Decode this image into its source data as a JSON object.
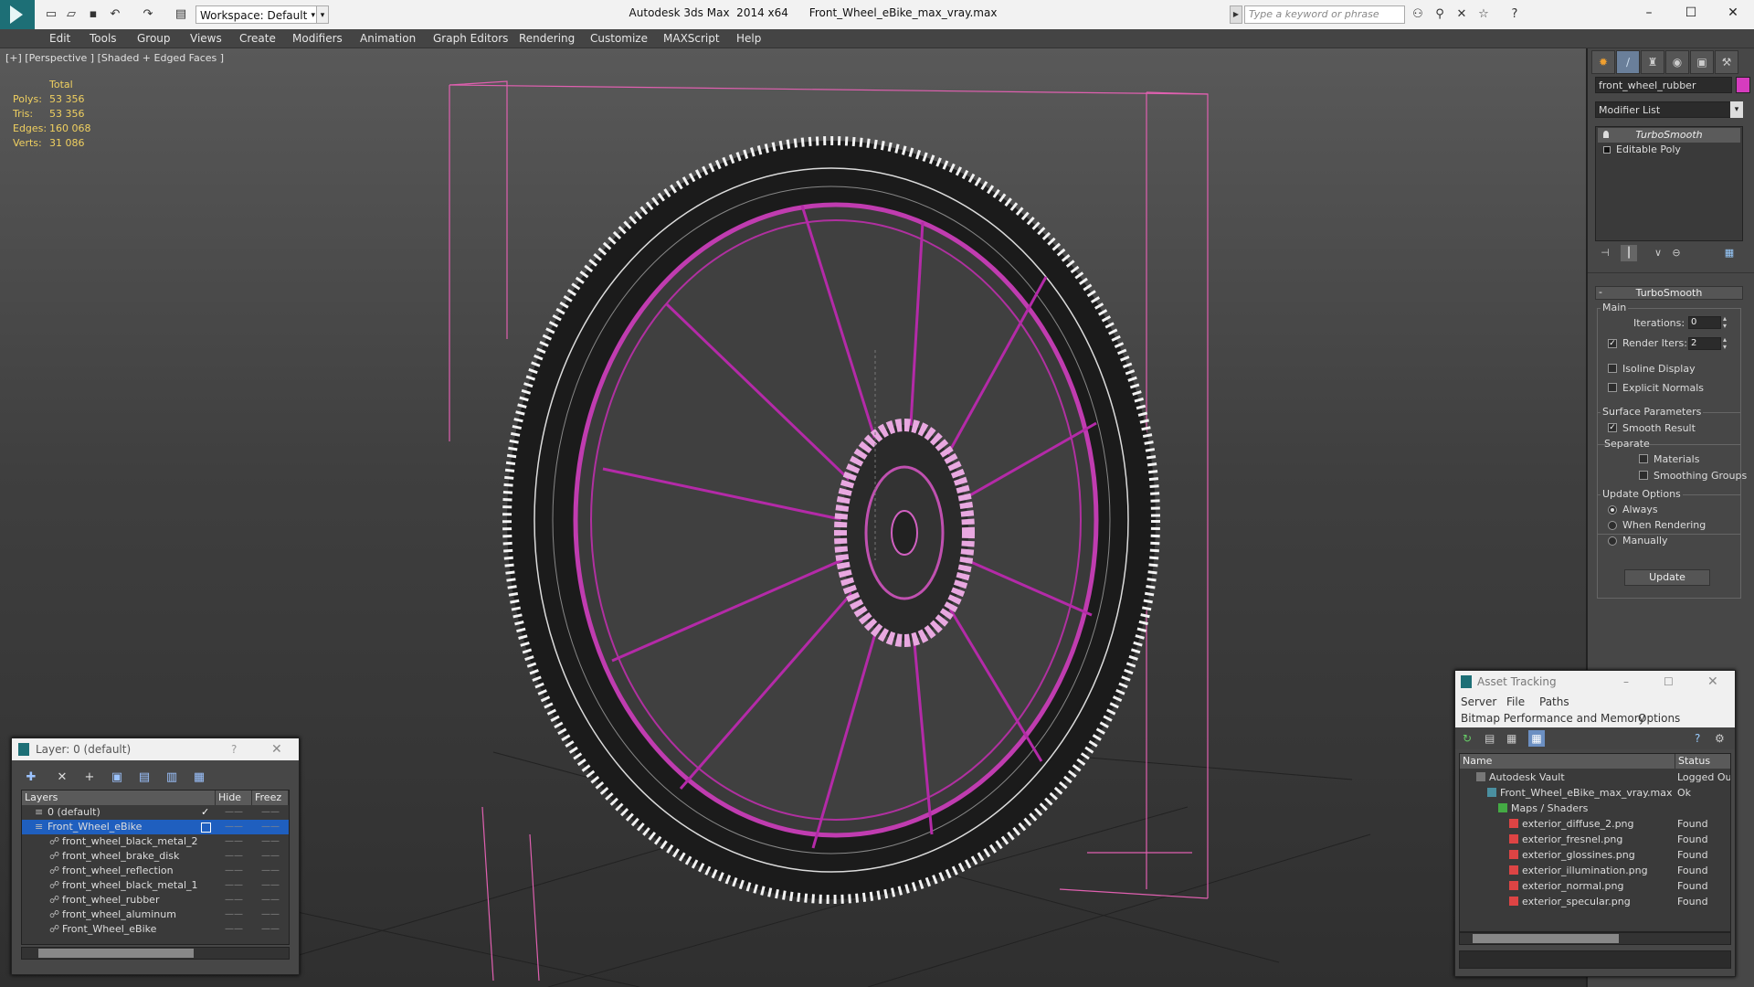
{
  "titlebar": {
    "workspace_label": "Workspace: Default",
    "window_title": "Autodesk 3ds Max  2014 x64      Front_Wheel_eBike_max_vray.max",
    "search_placeholder": "Type a keyword or phrase"
  },
  "menu": [
    "Edit",
    "Tools",
    "Group",
    "Views",
    "Create",
    "Modifiers",
    "Animation",
    "Graph Editors",
    "Rendering",
    "Customize",
    "MAXScript",
    "Help"
  ],
  "viewport": {
    "label": "[+] [Perspective ] [Shaded + Edged Faces ]",
    "stats": {
      "header": "Total",
      "rows": [
        {
          "label": "Polys:",
          "value": "53 356"
        },
        {
          "label": "Tris:",
          "value": "53 356"
        },
        {
          "label": "Edges:",
          "value": "160 068"
        },
        {
          "label": "Verts:",
          "value": "31 086"
        }
      ]
    }
  },
  "command_panel": {
    "object_name": "front_wheel_rubber",
    "object_color": "#d63cbe",
    "modifier_list": "Modifier List",
    "stack": [
      "TurboSmooth",
      "Editable Poly"
    ],
    "rollout_title": "TurboSmooth",
    "main_group": "Main",
    "iterations_label": "Iterations:",
    "iterations_value": "0",
    "render_iters_label": "Render Iters:",
    "render_iters_value": "2",
    "render_iters_checked": true,
    "isoline_label": "Isoline Display",
    "explicit_normals_label": "Explicit Normals",
    "surface_group": "Surface Parameters",
    "smooth_result_label": "Smooth Result",
    "separate_label": "Separate",
    "materials_label": "Materials",
    "smoothing_groups_label": "Smoothing Groups",
    "update_group": "Update Options",
    "always_label": "Always",
    "when_rendering_label": "When Rendering",
    "manually_label": "Manually",
    "update_button": "Update"
  },
  "layer_dialog": {
    "title": "Layer: 0 (default)",
    "help": "?",
    "columns": [
      "Layers",
      "Hide",
      "Freez"
    ],
    "rows": [
      {
        "name": "0 (default)",
        "level": 0,
        "selected": false
      },
      {
        "name": "Front_Wheel_eBike",
        "level": 0,
        "selected": true
      },
      {
        "name": "front_wheel_black_metal_2",
        "level": 1,
        "selected": false
      },
      {
        "name": "front_wheel_brake_disk",
        "level": 1,
        "selected": false
      },
      {
        "name": "front_wheel_reflection",
        "level": 1,
        "selected": false
      },
      {
        "name": "front_wheel_black_metal_1",
        "level": 1,
        "selected": false
      },
      {
        "name": "front_wheel_rubber",
        "level": 1,
        "selected": false
      },
      {
        "name": "front_wheel_aluminum",
        "level": 1,
        "selected": false
      },
      {
        "name": "Front_Wheel_eBike",
        "level": 1,
        "selected": false
      }
    ]
  },
  "asset_dialog": {
    "title": "Asset Tracking",
    "menu1": [
      "Server",
      "File",
      "Paths"
    ],
    "menu2": [
      "Bitmap Performance and Memory",
      "Options"
    ],
    "columns": [
      "Name",
      "Status"
    ],
    "rows": [
      {
        "name": "Autodesk Vault",
        "status": "Logged Ou",
        "indent": 1
      },
      {
        "name": "Front_Wheel_eBike_max_vray.max",
        "status": "Ok",
        "indent": 2
      },
      {
        "name": "Maps / Shaders",
        "status": "",
        "indent": 3
      },
      {
        "name": "exterior_diffuse_2.png",
        "status": "Found",
        "indent": 4
      },
      {
        "name": "exterior_fresnel.png",
        "status": "Found",
        "indent": 4
      },
      {
        "name": "exterior_glossines.png",
        "status": "Found",
        "indent": 4
      },
      {
        "name": "exterior_illumination.png",
        "status": "Found",
        "indent": 4
      },
      {
        "name": "exterior_normal.png",
        "status": "Found",
        "indent": 4
      },
      {
        "name": "exterior_specular.png",
        "status": "Found",
        "indent": 4
      }
    ]
  }
}
